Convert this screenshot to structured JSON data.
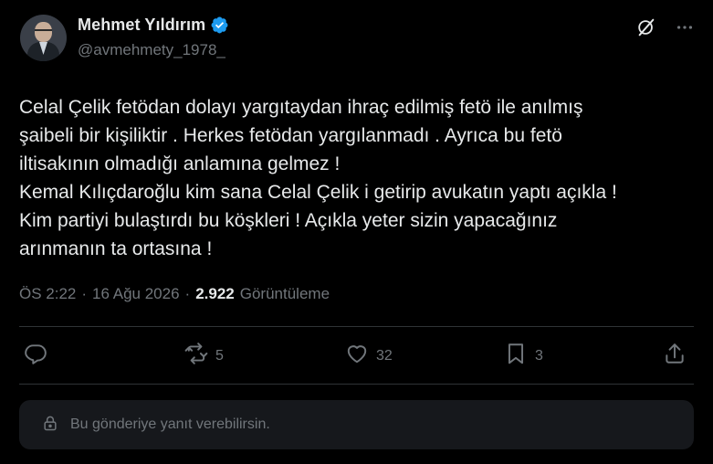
{
  "author": {
    "display_name": "Mehmet Yıldırım",
    "handle": "@avmehmety_1978_",
    "verified": true,
    "verified_color": "#1d9bf0"
  },
  "tweet": {
    "text": "Celal Çelik fetödan dolayı yargıtaydan ihraç edilmiş fetö ile anılmış\nşaibeli bir kişiliktir . Herkes fetödan yargılanmadı . Ayrıca bu fetö\niltisakının olmadığı anlamına gelmez !\nKemal Kılıçdaroğlu kim sana Celal Çelik i getirip avukatın yaptı açıkla !\nKim partiyi bulaştırdı bu köşkleri ! Açıkla yeter sizin yapacağınız\narınmanın ta ortasına !",
    "time": "ÖS 2:22",
    "date": "16 Ağu 2026",
    "views_count": "2.922",
    "views_label": "Görüntüleme",
    "separator": "·"
  },
  "actions": {
    "reply": {
      "icon": "reply-icon",
      "count": ""
    },
    "retweet": {
      "icon": "retweet-icon",
      "count": "5"
    },
    "like": {
      "icon": "heart-icon",
      "count": "32"
    },
    "bookmark": {
      "icon": "bookmark-icon",
      "count": "3"
    },
    "share": {
      "icon": "share-icon",
      "count": ""
    }
  },
  "top_icons": [
    "grok-icon",
    "more-icon"
  ],
  "reply_box": {
    "icon": "lock-icon",
    "text": "Bu gönderiye yanıt verebilirsin."
  },
  "colors": {
    "background": "#000000",
    "text": "#e7e9ea",
    "muted": "#71767b",
    "divider": "#2f3336",
    "reply_box_bg": "#16181c"
  }
}
